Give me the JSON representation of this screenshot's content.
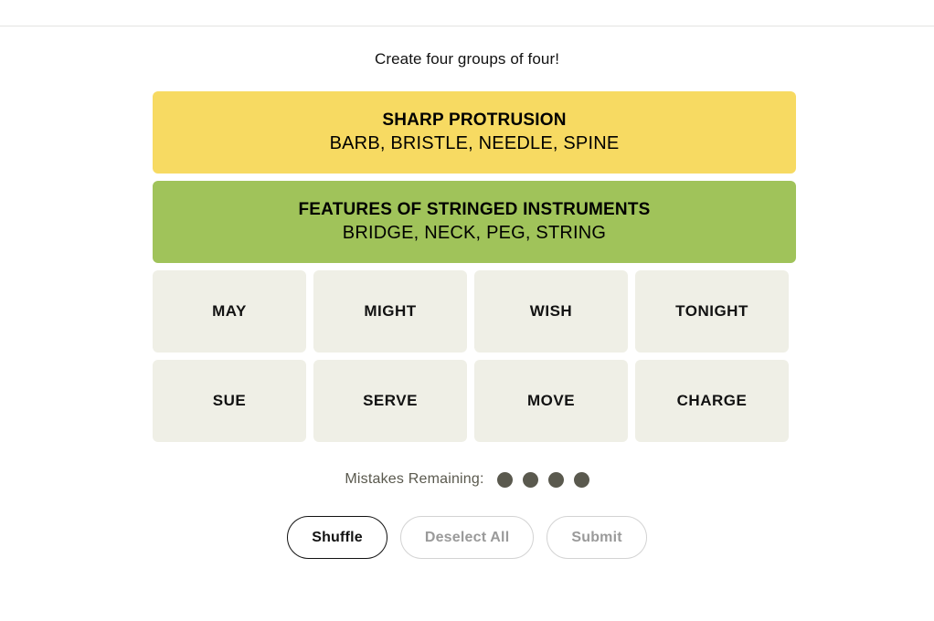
{
  "header": {
    "divider": true
  },
  "instruction": "Create four groups of four!",
  "board": {
    "solved_groups": [
      {
        "title": "SHARP PROTRUSION",
        "members": "BARB, BRISTLE, NEEDLE, SPINE",
        "color": "#f7da62",
        "difficulty": "yellow"
      },
      {
        "title": "FEATURES OF STRINGED INSTRUMENTS",
        "members": "BRIDGE, NECK, PEG, STRING",
        "color": "#a0c35a",
        "difficulty": "green"
      }
    ],
    "tile_color": "#efefe6",
    "rows": [
      [
        "MAY",
        "MIGHT",
        "WISH",
        "TONIGHT"
      ],
      [
        "SUE",
        "SERVE",
        "MOVE",
        "CHARGE"
      ]
    ]
  },
  "mistakes": {
    "label": "Mistakes Remaining:",
    "remaining": 4,
    "dot_color": "#5a594e"
  },
  "actions": {
    "shuffle_label": "Shuffle",
    "deselect_label": "Deselect All",
    "submit_label": "Submit"
  }
}
